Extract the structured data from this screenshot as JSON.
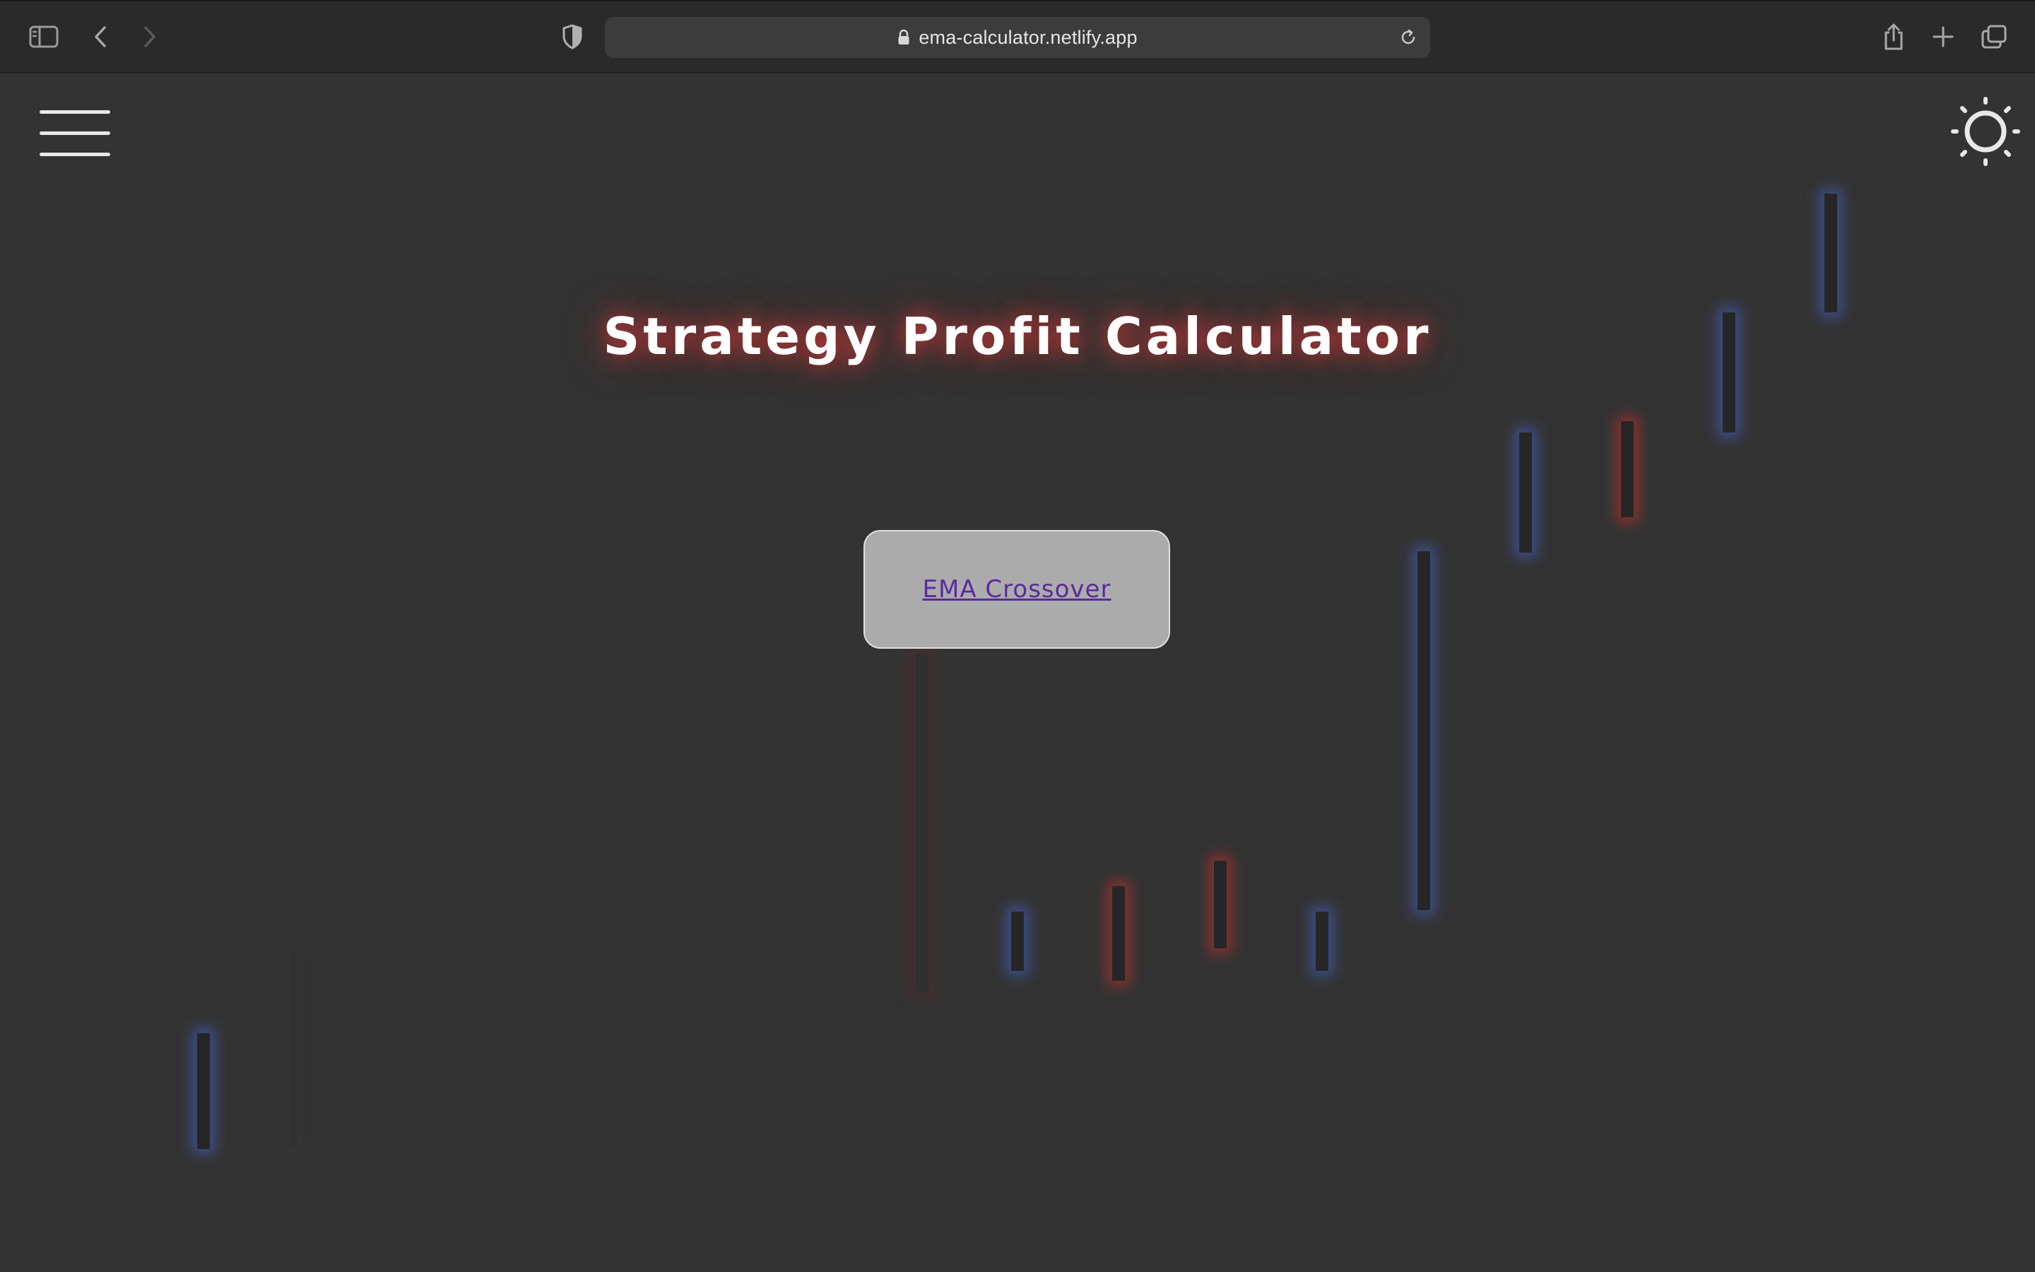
{
  "browser": {
    "url": "ema-calculator.netlify.app",
    "icons": {
      "sidebar": "sidebar-icon",
      "back": "chevron-left-icon",
      "forward": "chevron-right-icon",
      "shield": "privacy-shield-icon",
      "lock": "lock-icon",
      "reload": "reload-icon",
      "share": "share-icon",
      "new_tab": "plus-icon",
      "tabs": "tab-overview-icon"
    }
  },
  "page": {
    "title": "Strategy Profit Calculator",
    "strategies": [
      {
        "label": "EMA Crossover"
      }
    ],
    "menu_icon": "hamburger-icon",
    "theme_icon": "sun-icon"
  },
  "colors": {
    "background": "#333333",
    "title_glow": "#e63c3c",
    "card": "#ababab",
    "link": "#5b2a9e",
    "candle_blue_glow": "#4664c8",
    "candle_red_glow": "#c8322d"
  }
}
